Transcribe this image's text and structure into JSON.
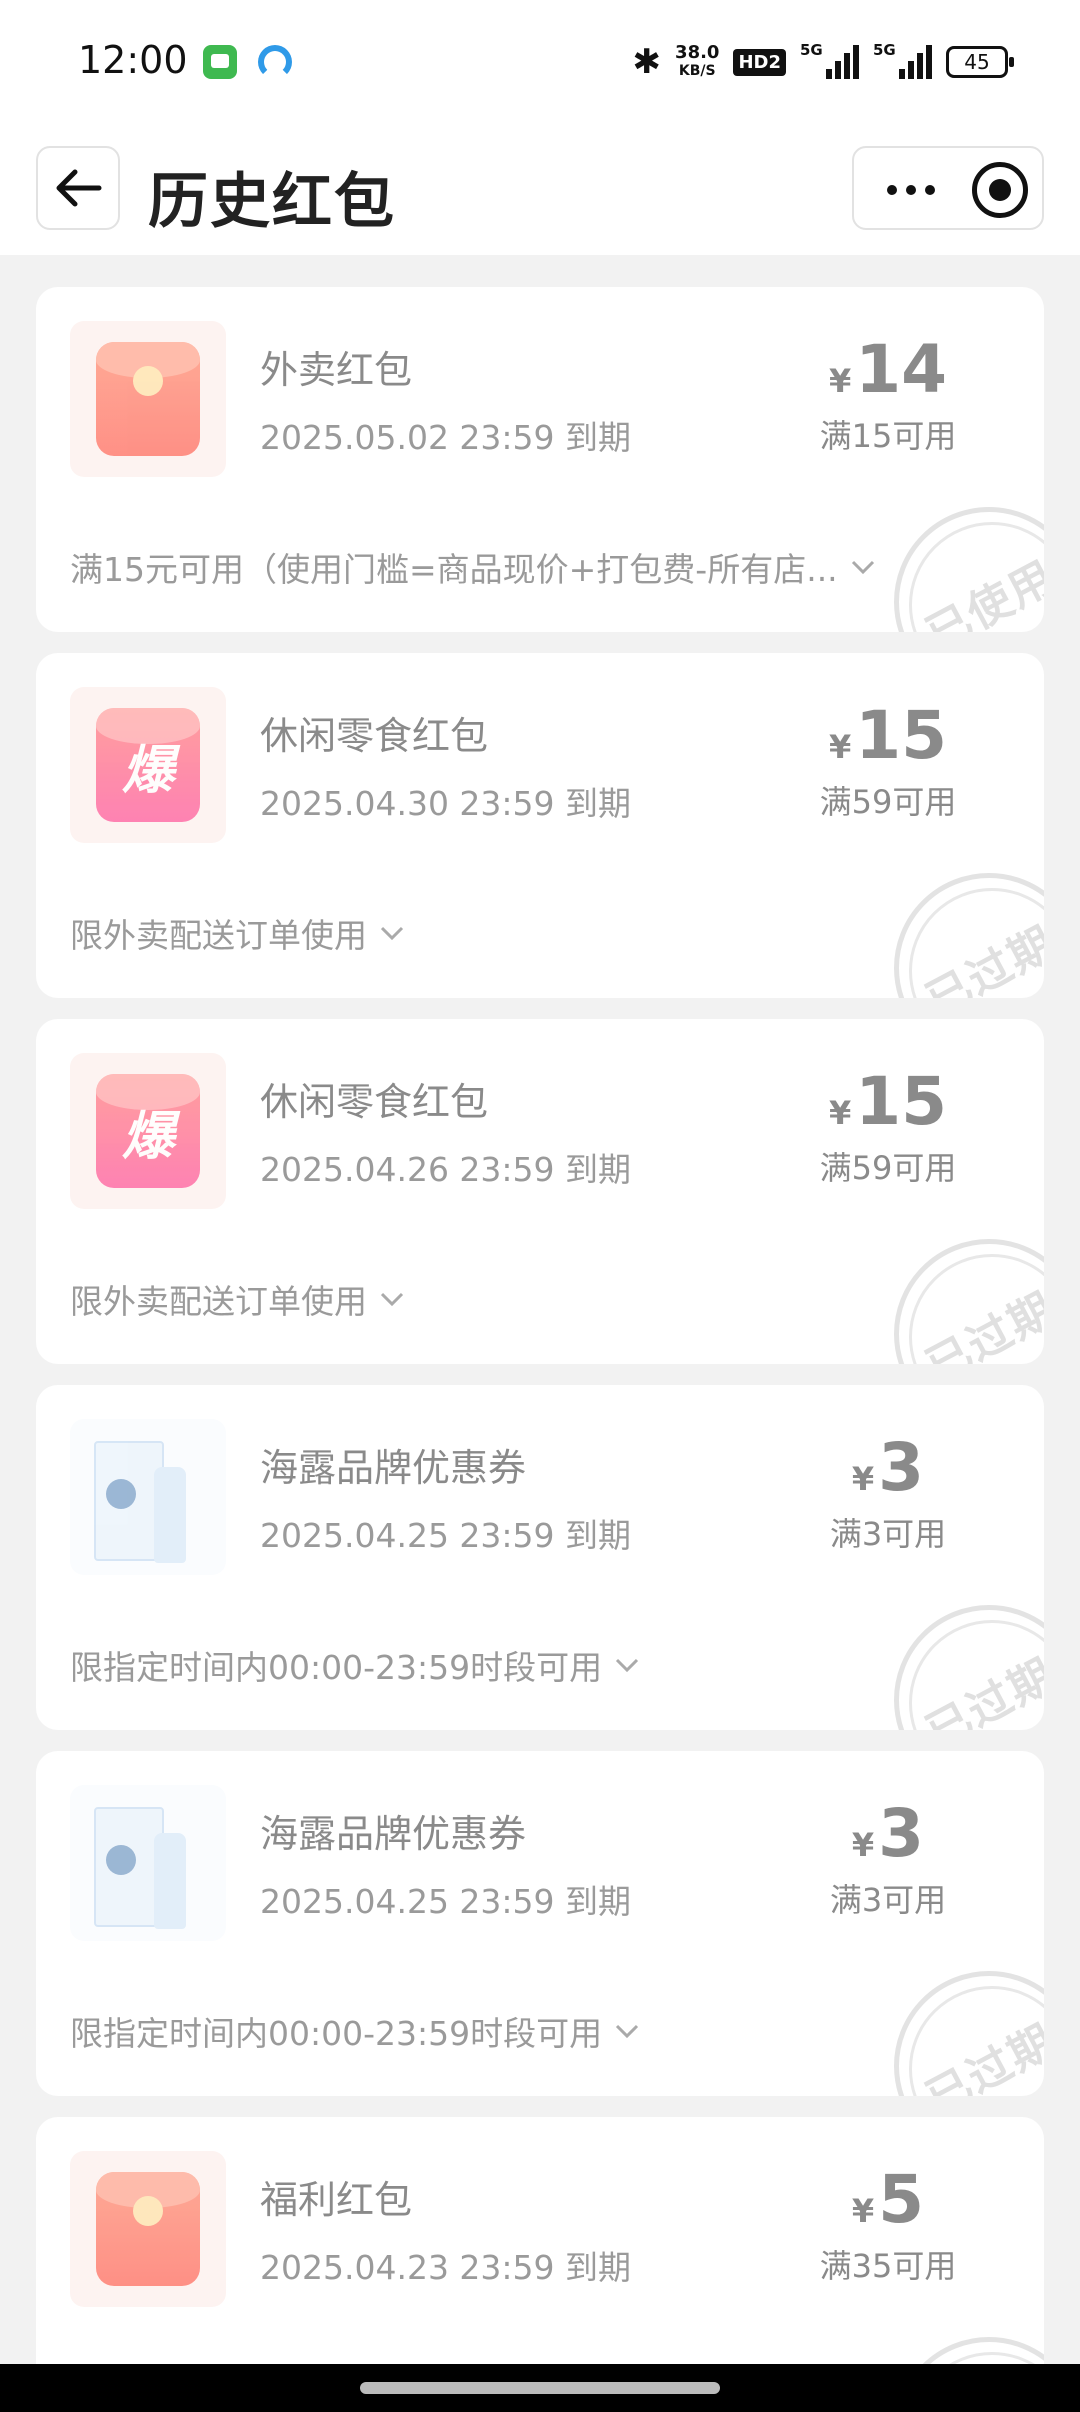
{
  "status_bar": {
    "time": "12:00",
    "net_speed": "38.0",
    "net_unit": "KB/S",
    "hd": "HD2",
    "sig1": "5G",
    "sig2": "5G",
    "battery": "45"
  },
  "header": {
    "title": "历史红包"
  },
  "cards": [
    {
      "icon": "red-envelope-icon",
      "title": "外卖红包",
      "expiry": "2025.05.02 23:59 到期",
      "currency": "¥",
      "amount": "14",
      "condition": "满15可用",
      "note": "满15元可用（使用门槛=商品现价+打包费-所有店...",
      "stamp": "已使用"
    },
    {
      "icon": "bao-icon",
      "bao_char": "爆",
      "title": "休闲零食红包",
      "expiry": "2025.04.30 23:59 到期",
      "currency": "¥",
      "amount": "15",
      "condition": "满59可用",
      "note": "限外卖配送订单使用",
      "stamp": "已过期"
    },
    {
      "icon": "bao-icon",
      "bao_char": "爆",
      "title": "休闲零食红包",
      "expiry": "2025.04.26 23:59 到期",
      "currency": "¥",
      "amount": "15",
      "condition": "满59可用",
      "note": "限外卖配送订单使用",
      "stamp": "已过期"
    },
    {
      "icon": "product-image",
      "title": "海露品牌优惠券",
      "expiry": "2025.04.25 23:59 到期",
      "currency": "¥",
      "amount": "3",
      "condition": "满3可用",
      "note": "限指定时间内00:00-23:59时段可用",
      "stamp": "已过期"
    },
    {
      "icon": "product-image",
      "title": "海露品牌优惠券",
      "expiry": "2025.04.25 23:59 到期",
      "currency": "¥",
      "amount": "3",
      "condition": "满3可用",
      "note": "限指定时间内00:00-23:59时段可用",
      "stamp": "已过期"
    },
    {
      "icon": "red-envelope-icon",
      "title": "福利红包",
      "expiry": "2025.04.23 23:59 到期",
      "currency": "¥",
      "amount": "5",
      "condition": "满35可用",
      "note": "",
      "stamp": ""
    }
  ]
}
